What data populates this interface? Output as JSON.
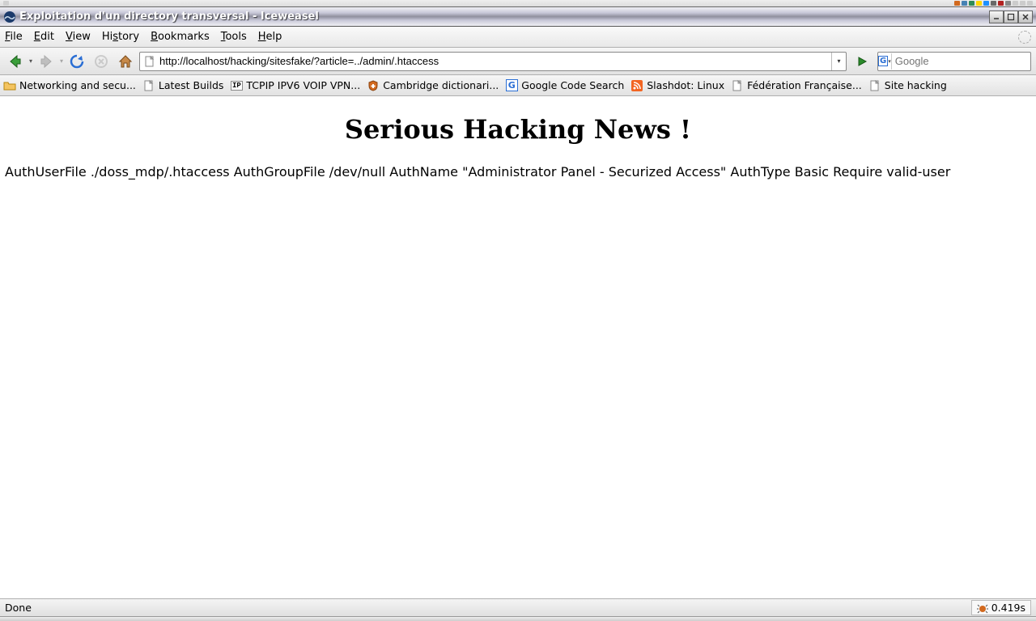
{
  "window": {
    "title": "Exploitation d'un directory transversal - Iceweasel"
  },
  "menu": {
    "file": "File",
    "edit": "Edit",
    "view": "View",
    "history": "History",
    "bookmarks": "Bookmarks",
    "tools": "Tools",
    "help": "Help"
  },
  "nav": {
    "url": "http://localhost/hacking/sitesfake/?article=../admin/.htaccess",
    "search_placeholder": "Google",
    "engine_label": "G"
  },
  "bookmarks": [
    {
      "label": "Networking and secu...",
      "icon": "folder"
    },
    {
      "label": "Latest Builds",
      "icon": "page"
    },
    {
      "label": "TCPIP IPV6 VOIP VPN...",
      "icon": "ip"
    },
    {
      "label": "Cambridge dictionari...",
      "icon": "shield"
    },
    {
      "label": "Google Code Search",
      "icon": "gcode"
    },
    {
      "label": "Slashdot: Linux",
      "icon": "rss"
    },
    {
      "label": "Fédération Française...",
      "icon": "page"
    },
    {
      "label": "Site hacking",
      "icon": "page"
    }
  ],
  "page": {
    "heading": "Serious Hacking News !",
    "body": "AuthUserFile ./doss_mdp/.htaccess AuthGroupFile /dev/null AuthName \"Administrator Panel - Securized Access\" AuthType Basic Require valid-user"
  },
  "status": {
    "text": "Done",
    "timing": "0.419s"
  }
}
